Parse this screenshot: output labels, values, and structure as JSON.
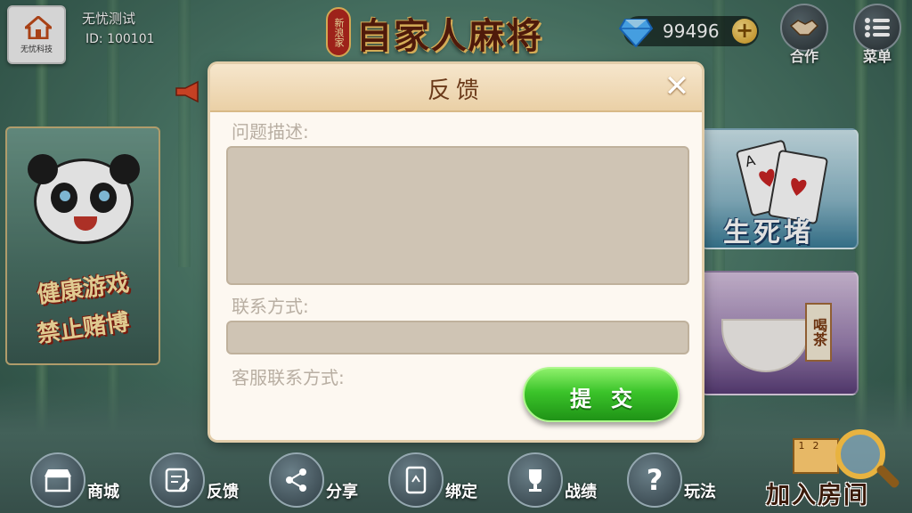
{
  "app": {
    "title": "自家人麻将",
    "title_badge": "新浪家"
  },
  "user": {
    "name": "无忧测试",
    "id_text": "ID: 100101",
    "avatar_brand": "无忧科技"
  },
  "currency": {
    "value": "99496",
    "add_symbol": "+"
  },
  "top_buttons": {
    "cooperate": "合作",
    "menu": "菜单"
  },
  "poster": {
    "line1": "健康游戏",
    "line2": "禁止赌博"
  },
  "game_cards": [
    {
      "label": "生死堵"
    },
    {
      "label": "喝茶"
    }
  ],
  "modal": {
    "title": "反馈",
    "close_symbol": "✕",
    "description_label": "问题描述:",
    "description_value": "",
    "contact_label": "联系方式:",
    "contact_value": "",
    "service_label": "客服联系方式:",
    "submit_label": "提交"
  },
  "bottom_bar": [
    {
      "label": "商城",
      "icon": "shop-icon"
    },
    {
      "label": "反馈",
      "icon": "feedback-icon"
    },
    {
      "label": "分享",
      "icon": "share-icon"
    },
    {
      "label": "绑定",
      "icon": "bind-phone-icon"
    },
    {
      "label": "战绩",
      "icon": "trophy-icon"
    },
    {
      "label": "玩法",
      "icon": "question-icon"
    }
  ],
  "join_room": {
    "label": "加入房间",
    "grid": [
      "1",
      "2",
      ""
    ]
  },
  "colors": {
    "modal_header": "#ead0a6",
    "field_bg": "#cfc4b4",
    "submit_green": "#3bc42a",
    "title_brown": "#5a1e0d"
  }
}
